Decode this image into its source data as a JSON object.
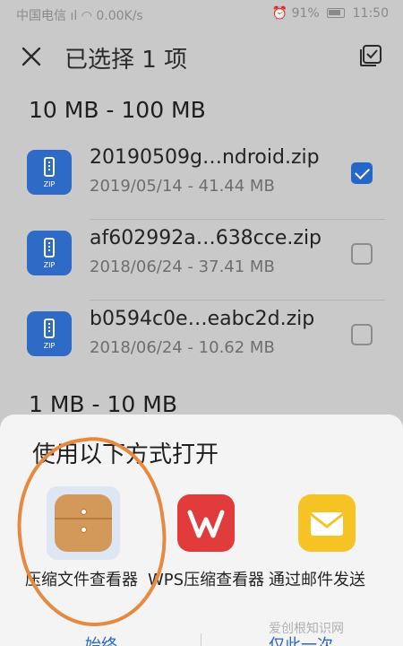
{
  "status_bar": {
    "carrier": "中国电信",
    "network_speed": "0.00K/s",
    "battery": "91%",
    "time": "11:50"
  },
  "app_bar": {
    "title": "已选择 1 项"
  },
  "groups": [
    {
      "header": "10 MB - 100 MB",
      "files": [
        {
          "name": "20190509g…ndroid.zip",
          "meta": "2019/05/14 - 41.44 MB",
          "checked": true
        },
        {
          "name": "af602992a…638cce.zip",
          "meta": "2018/06/24 - 37.41 MB",
          "checked": false
        },
        {
          "name": "b0594c0e…eabc2d.zip",
          "meta": "2018/06/24 - 10.62 MB",
          "checked": false
        }
      ]
    },
    {
      "header": "1 MB - 10 MB",
      "files": []
    }
  ],
  "zip_label": "ZIP",
  "sheet": {
    "title": "使用以下方式打开",
    "options": [
      {
        "label": "压缩文件查看器",
        "icon": "archive-box-icon",
        "color": "#d3995a"
      },
      {
        "label": "WPS压缩查看器",
        "icon": "wps-icon",
        "color": "#e23b3b"
      },
      {
        "label": "通过邮件发送",
        "icon": "mail-icon",
        "color": "#f6c324"
      }
    ],
    "bottom_left": "始终",
    "bottom_right": "仅此一次"
  },
  "watermark": "爱创根知识网",
  "colors": {
    "accent": "#2567c9",
    "highlight": "#e7893f"
  }
}
